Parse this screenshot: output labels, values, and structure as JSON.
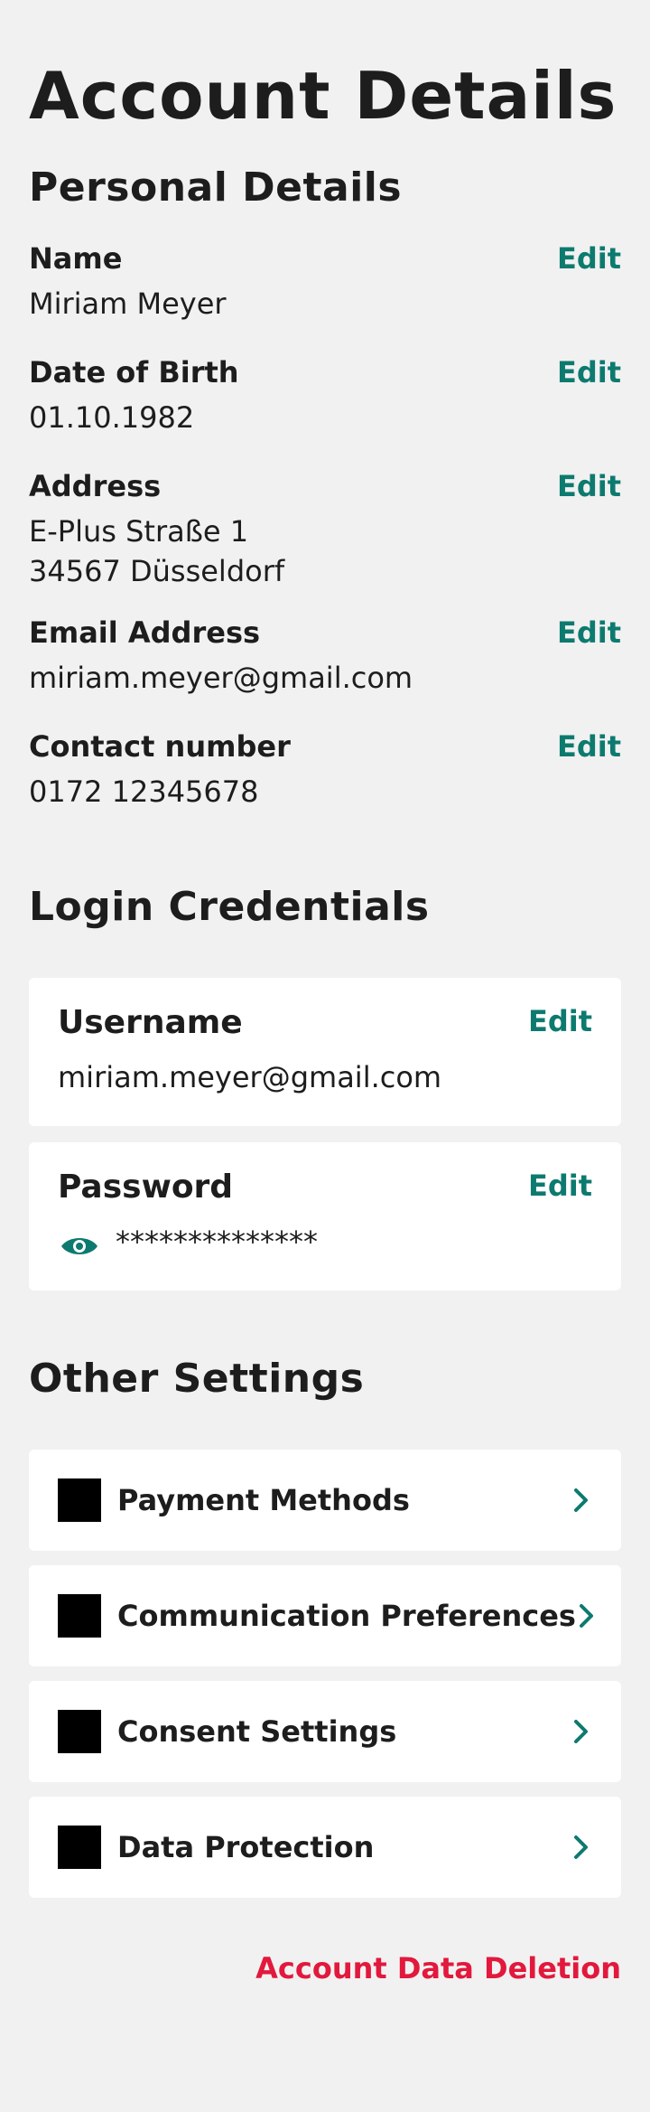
{
  "page": {
    "title": "Account Details"
  },
  "personal_details": {
    "title": "Personal Details",
    "edit_label": "Edit",
    "items": [
      {
        "label": "Name",
        "value": "Miriam Meyer"
      },
      {
        "label": "Date of Birth",
        "value": "01.10.1982"
      },
      {
        "label": "Address",
        "value": "E-Plus Straße 1\n34567 Düsseldorf"
      },
      {
        "label": "Email Address",
        "value": "miriam.meyer@gmail.com"
      },
      {
        "label": "Contact number",
        "value": "0172 12345678"
      }
    ]
  },
  "login_credentials": {
    "title": "Login Credentials",
    "edit_label": "Edit",
    "username": {
      "label": "Username",
      "value": "miriam.meyer@gmail.com"
    },
    "password": {
      "label": "Password",
      "value": "**************",
      "icon": "eye-icon"
    }
  },
  "other_settings": {
    "title": "Other Settings",
    "items": [
      {
        "label": "Payment Methods",
        "icon": "placeholder-square-icon"
      },
      {
        "label": "Communication Preferences",
        "icon": "placeholder-square-icon"
      },
      {
        "label": "Consent Settings",
        "icon": "placeholder-square-icon"
      },
      {
        "label": "Data Protection",
        "icon": "placeholder-square-icon"
      }
    ]
  },
  "account_deletion": {
    "label": "Account Data Deletion"
  },
  "colors": {
    "background": "#f1f1f1",
    "card": "#ffffff",
    "accent": "#0d7a6f",
    "danger": "#e2183d",
    "text": "#1d1d1d"
  }
}
